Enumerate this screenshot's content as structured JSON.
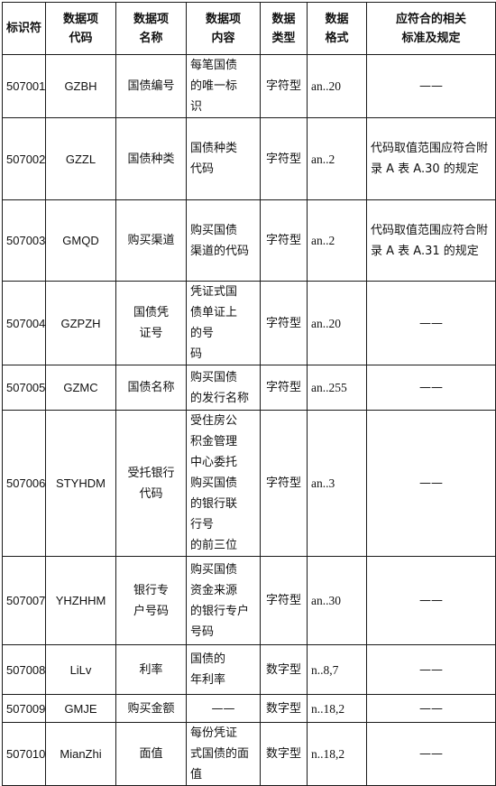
{
  "header": {
    "id": "标识符",
    "code_l1": "数据项",
    "code_l2": "代码",
    "name_l1": "数据项",
    "name_l2": "名称",
    "content_l1": "数据项",
    "content_l2": "内容",
    "type_l1": "数据",
    "type_l2": "类型",
    "format_l1": "数据",
    "format_l2": "格式",
    "standard_l1": "应符合的相关",
    "standard_l2": "标准及规定"
  },
  "rows": [
    {
      "id": "507001",
      "code": "GZBH",
      "name": "国债编号",
      "content": "每笔国债的唯一标识",
      "type": "字符型",
      "format": "an..20",
      "standard": "——"
    },
    {
      "id": "507002",
      "code": "GZZL",
      "name": "国债种类",
      "content": "国债种类代码",
      "type": "字符型",
      "format": "an..2",
      "standard": "代码取值范围应符合附录 A 表 A.30 的规定"
    },
    {
      "id": "507003",
      "code": "GMQD",
      "name": "购买渠道",
      "content": "购买国债渠道的代码",
      "type": "字符型",
      "format": "an..2",
      "standard": "代码取值范围应符合附录 A 表 A.31 的规定"
    },
    {
      "id": "507004",
      "code": "GZPZH",
      "name": "国债凭证号",
      "content": "凭证式国债单证上的号码",
      "type": "字符型",
      "format": "an..20",
      "standard": "——"
    },
    {
      "id": "507005",
      "code": "GZMC",
      "name": "国债名称",
      "content": "购买国债的发行名称",
      "type": "字符型",
      "format": "an..255",
      "standard": "——"
    },
    {
      "id": "507006",
      "code": "STYHDM",
      "name": "受托银行代码",
      "content": "受住房公积金管理中心委托购买国债的银行联行号的前三位",
      "type": "字符型",
      "format": "an..3",
      "standard": "——"
    },
    {
      "id": "507007",
      "code": "YHZHHM",
      "name": "银行专户号码",
      "content": "购买国债资金来源的银行专户号码",
      "type": "字符型",
      "format": "an..30",
      "standard": "——"
    },
    {
      "id": "507008",
      "code": "LiLv",
      "name": "利率",
      "content": "国债的年利率",
      "type": "数字型",
      "format": "n..8,7",
      "standard": "——"
    },
    {
      "id": "507009",
      "code": "GMJE",
      "name": "购买金额",
      "content": "——",
      "type": "数字型",
      "format": "n..18,2",
      "standard": "——"
    },
    {
      "id": "507010",
      "code": "MianZhi",
      "name": "面值",
      "content": "每份凭证式国债的面值",
      "type": "数字型",
      "format": "n..18,2",
      "standard": "——"
    }
  ]
}
